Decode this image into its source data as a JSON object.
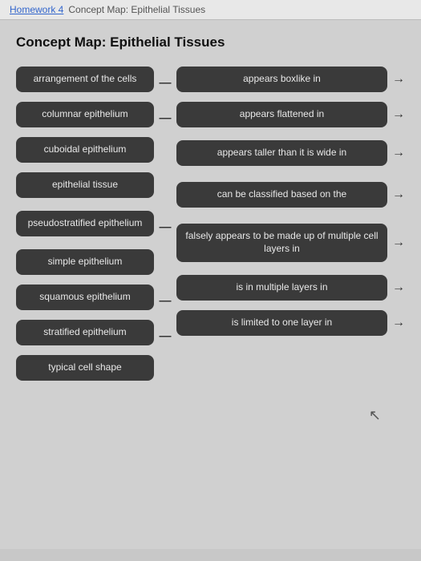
{
  "breadcrumb": {
    "link_label": "Homework 4",
    "separator": "",
    "current": "Concept Map: Epithelial Tissues"
  },
  "page_title": "Concept Map: Epithelial Tissues",
  "left_pills": [
    {
      "id": "pill-arrangement",
      "text": "arrangement of the cells"
    },
    {
      "id": "pill-columnar",
      "text": "columnar epithelium"
    },
    {
      "id": "pill-cuboidal",
      "text": "cuboidal epithelium"
    },
    {
      "id": "pill-epithelial",
      "text": "epithelial tissue"
    },
    {
      "id": "pill-pseudostratified",
      "text": "pseudostratified epithelium"
    },
    {
      "id": "pill-simple",
      "text": "simple epithelium"
    },
    {
      "id": "pill-squamous",
      "text": "squamous epithelium"
    },
    {
      "id": "pill-stratified",
      "text": "stratified epithelium"
    },
    {
      "id": "pill-typical",
      "text": "typical cell shape"
    }
  ],
  "right_pills": [
    {
      "id": "rpill-1",
      "text": "appears boxlike in",
      "has_arrow": true
    },
    {
      "id": "rpill-2",
      "text": "appears flattened in",
      "has_arrow": true
    },
    {
      "id": "rpill-3",
      "text": "appears taller than it is wide in",
      "has_arrow": true
    },
    {
      "id": "rpill-4",
      "text": "can be classified based on the",
      "has_arrow": true
    },
    {
      "id": "rpill-5",
      "text": "falsely appears to be made up of multiple cell layers in",
      "has_arrow": true
    },
    {
      "id": "rpill-6",
      "text": "is in multiple layers in",
      "has_arrow": true
    },
    {
      "id": "rpill-7",
      "text": "is limited to one layer in",
      "has_arrow": true
    }
  ],
  "connectors": {
    "dash": "—",
    "arrow": "→"
  }
}
